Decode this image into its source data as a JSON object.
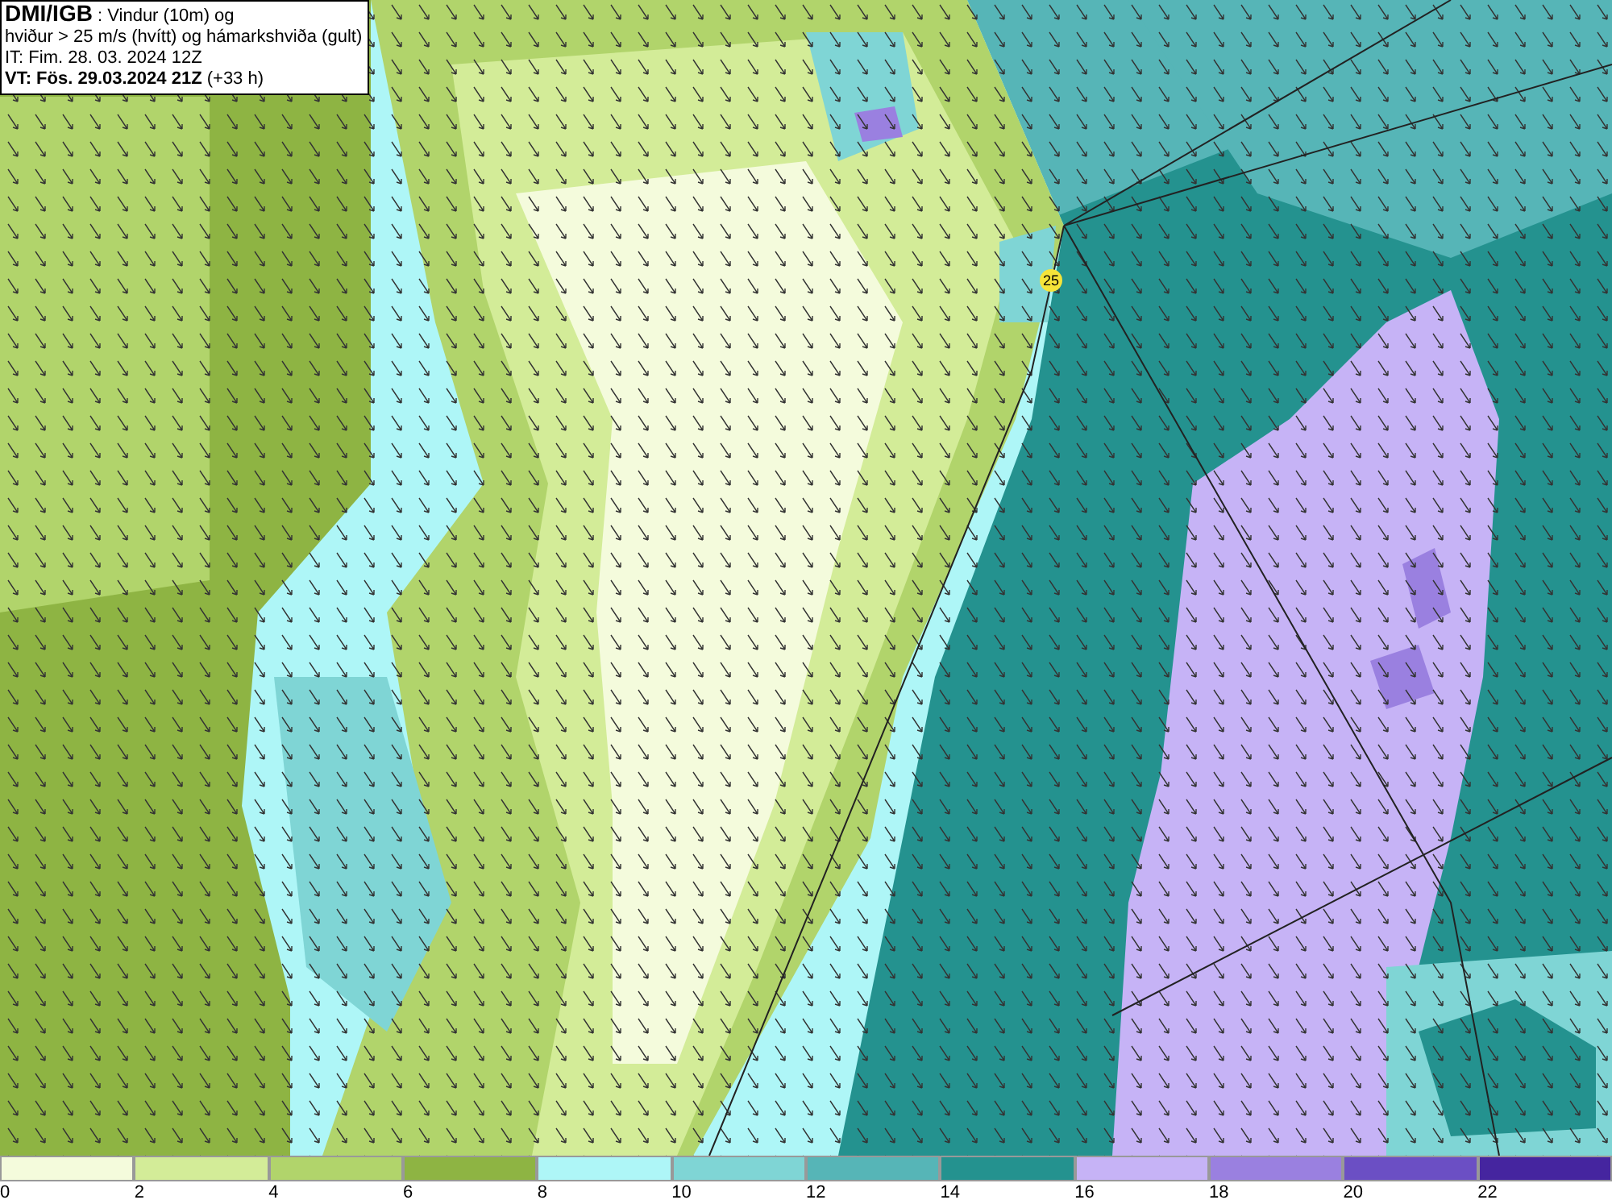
{
  "header": {
    "line_1": "**DMI/IGB** : Vindur (10m) og",
    "line_2": "hviður > 25 m/s (hvítt) og hámarkshviða (gult)",
    "line_3": "IT: Fim. 28. 03. 2024 12Z",
    "line_4": "**VT: Fös. 29.03.2024 21Z** (+33 h)"
  },
  "map": {
    "max_gust_marker": "25"
  },
  "legend": [
    {
      "label": "0",
      "color": "#f4fbdc"
    },
    {
      "label": "2",
      "color": "#d3ec98"
    },
    {
      "label": "4",
      "color": "#b1d46b"
    },
    {
      "label": "6",
      "color": "#8eb443"
    },
    {
      "label": "8",
      "color": "#aef6f7"
    },
    {
      "label": "10",
      "color": "#7fd5d5"
    },
    {
      "label": "12",
      "color": "#56b5b7"
    },
    {
      "label": "14",
      "color": "#24928f"
    },
    {
      "label": "16",
      "color": "#c6b3f6"
    },
    {
      "label": "18",
      "color": "#9a80e0"
    },
    {
      "label": "20",
      "color": "#6b4fc4"
    },
    {
      "label": "22",
      "color": "#45259f"
    }
  ]
}
